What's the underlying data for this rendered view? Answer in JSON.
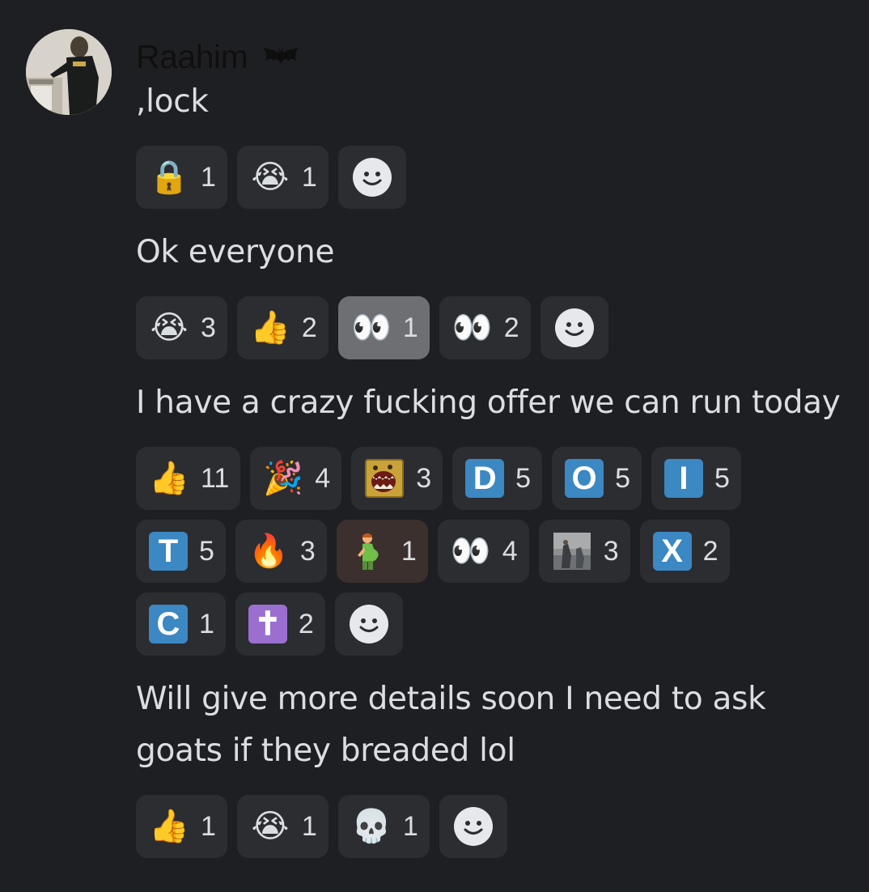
{
  "user": {
    "name": "Raahim",
    "badge_icon": "bat-icon"
  },
  "colors": {
    "background": "#1e1f22",
    "reaction_bg": "#2b2d31",
    "reaction_active_bg": "#6d6f72",
    "text": "#dbdee1",
    "tile_blue": "#3b88c3",
    "tile_purple": "#9b6fd0"
  },
  "messages": [
    {
      "text": ",lock",
      "reactions": [
        {
          "icon": "lock-icon",
          "glyph": "🔒",
          "count": "1"
        },
        {
          "icon": "crying-face-icon",
          "glyph": "😭",
          "count": "1"
        }
      ]
    },
    {
      "text": "Ok everyone",
      "reactions": [
        {
          "icon": "crying-face-icon",
          "glyph": "😭",
          "count": "3"
        },
        {
          "icon": "thumbs-up-icon",
          "glyph": "👍",
          "count": "2"
        },
        {
          "icon": "eyes-icon",
          "glyph": "👀",
          "count": "1",
          "active": true
        },
        {
          "icon": "eyes-icon",
          "glyph": "👀",
          "count": "2"
        }
      ]
    },
    {
      "text": "I have a crazy fucking offer we can run today",
      "reactions": [
        {
          "icon": "thumbs-up-icon",
          "glyph": "👍",
          "count": "11"
        },
        {
          "icon": "party-popper-icon",
          "glyph": "🎉",
          "count": "4"
        },
        {
          "icon": "screaming-custom-emoji-icon",
          "count": "3"
        },
        {
          "icon": "letter-d-icon",
          "letter": "D",
          "count": "5"
        },
        {
          "icon": "letter-o-icon",
          "letter": "O",
          "count": "5"
        },
        {
          "icon": "letter-i-icon",
          "letter": "I",
          "count": "5"
        },
        {
          "icon": "letter-t-icon",
          "letter": "T",
          "count": "5"
        },
        {
          "icon": "fire-icon",
          "glyph": "🔥",
          "count": "3"
        },
        {
          "icon": "pregnant-man-icon",
          "glyph": "🫃",
          "count": "1",
          "brown": true
        },
        {
          "icon": "eyes-icon",
          "glyph": "👀",
          "count": "4"
        },
        {
          "icon": "photo-custom-emoji-icon",
          "count": "3"
        },
        {
          "icon": "letter-x-icon",
          "letter": "X",
          "count": "2"
        },
        {
          "icon": "letter-c-icon",
          "letter": "C",
          "count": "1"
        },
        {
          "icon": "latin-cross-icon",
          "letter": "✝",
          "purple": true,
          "count": "2"
        }
      ]
    },
    {
      "text": "Will give more details soon I need to ask goats if they breaded lol",
      "reactions": [
        {
          "icon": "thumbs-up-icon",
          "glyph": "👍",
          "count": "1"
        },
        {
          "icon": "crying-face-icon",
          "glyph": "😭",
          "count": "1"
        },
        {
          "icon": "skull-icon",
          "glyph": "💀",
          "count": "1"
        }
      ]
    }
  ]
}
